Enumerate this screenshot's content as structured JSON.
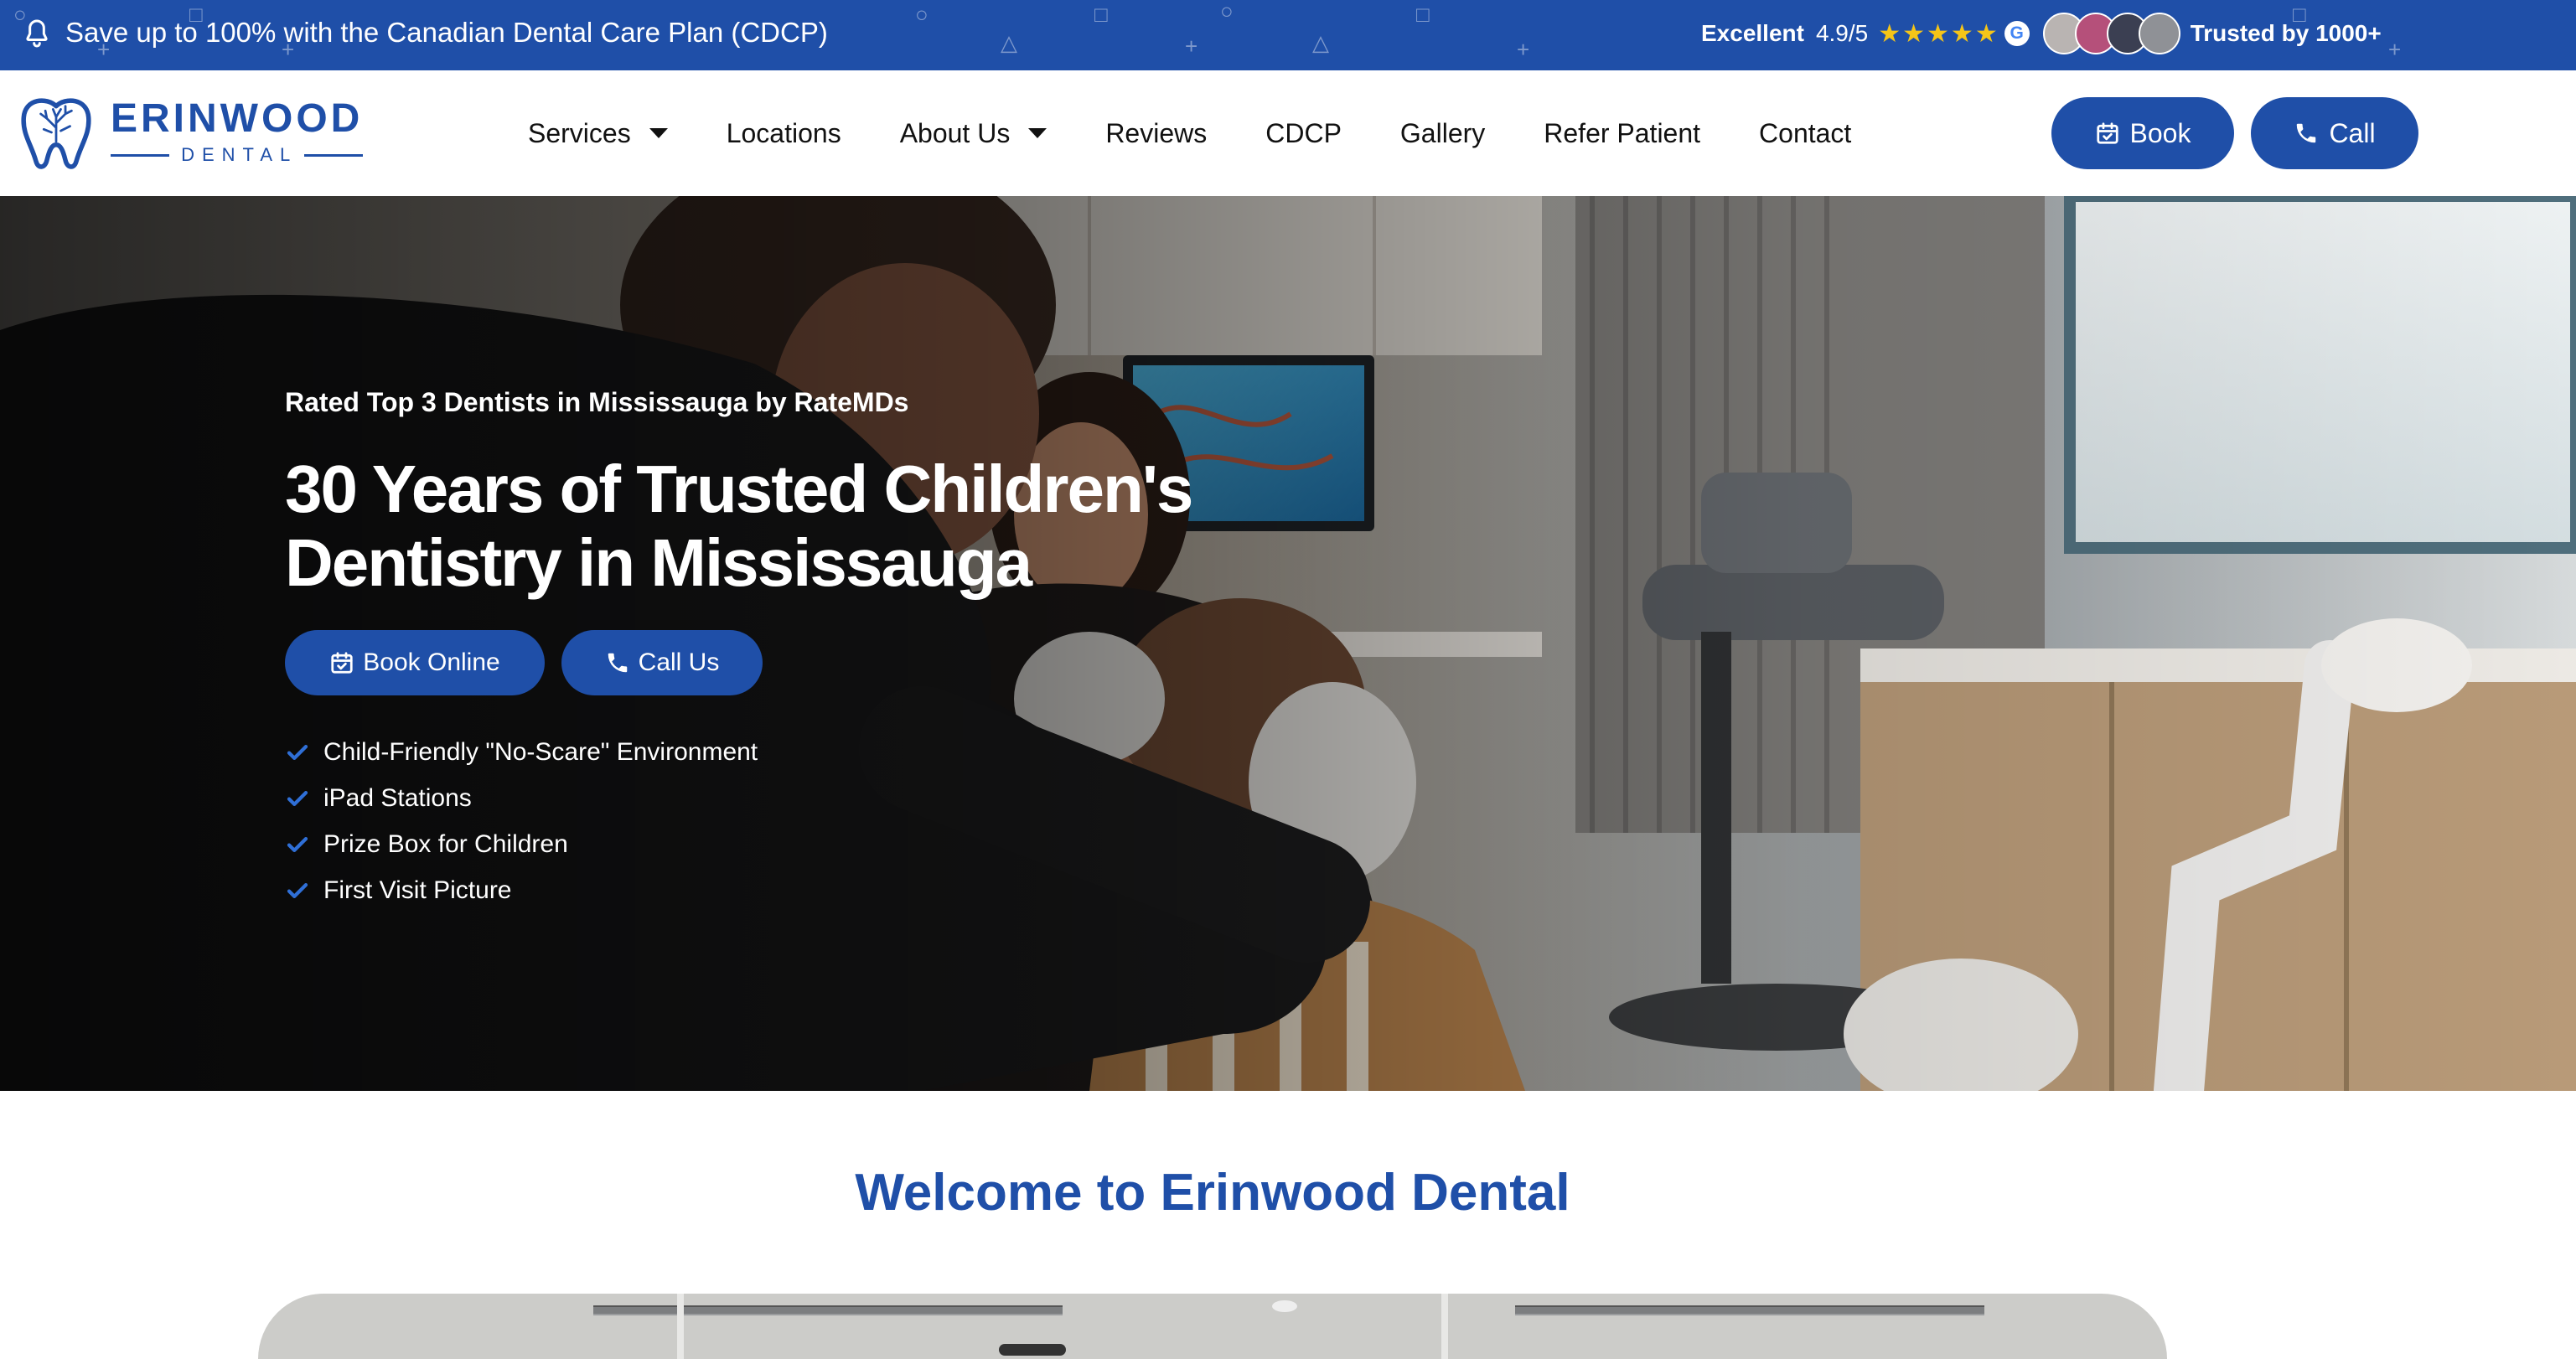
{
  "announcement": {
    "text": "Save up to 100% with the Canadian Dental Care Plan (CDCP)",
    "icon": "bell-icon",
    "rating_label": "Excellent",
    "rating_score": "4.9/5",
    "stars": "★★★★★",
    "google_badge": "G",
    "trust_text": "Trusted by 1000+"
  },
  "header": {
    "logo_name": "ERINWOOD",
    "logo_sub": "DENTAL",
    "nav": [
      {
        "label": "Services",
        "has_dropdown": true
      },
      {
        "label": "Locations",
        "has_dropdown": false
      },
      {
        "label": "About Us",
        "has_dropdown": true
      },
      {
        "label": "Reviews",
        "has_dropdown": false
      },
      {
        "label": "CDCP",
        "has_dropdown": false
      },
      {
        "label": "Gallery",
        "has_dropdown": false
      },
      {
        "label": "Refer Patient",
        "has_dropdown": false
      },
      {
        "label": "Contact",
        "has_dropdown": false
      }
    ],
    "book_label": "Book",
    "call_label": "Call"
  },
  "hero": {
    "kicker": "Rated Top 3 Dentists in Mississauga by RateMDs",
    "title": "30 Years of Trusted Children's Dentistry in Mississauga",
    "book_online_label": "Book Online",
    "call_us_label": "Call Us",
    "features": [
      "Child-Friendly \"No-Scare\" Environment",
      "iPad Stations",
      "Prize Box for Children",
      "First Visit Picture"
    ]
  },
  "welcome": {
    "heading": "Welcome to Erinwood Dental"
  },
  "colors": {
    "brand_blue": "#1f4fa8",
    "star_gold": "#f5c518",
    "check_blue": "#2f6fd6",
    "white": "#ffffff"
  }
}
